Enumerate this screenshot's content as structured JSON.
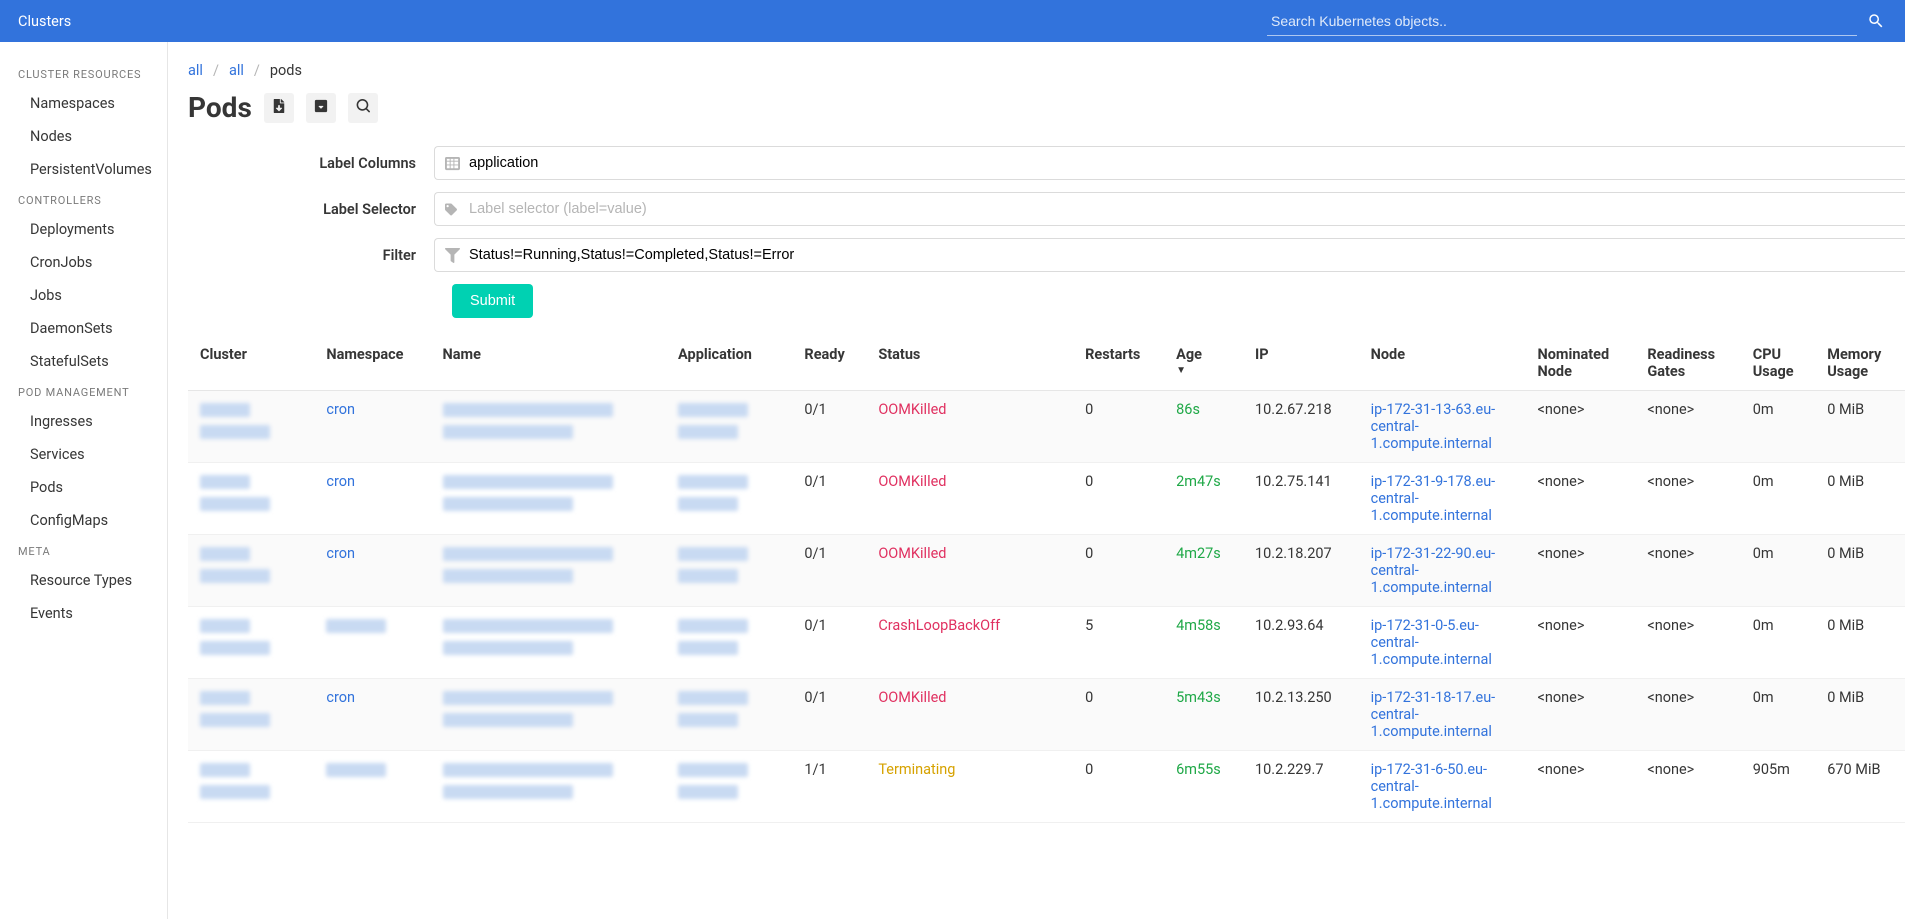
{
  "topbar": {
    "title": "Clusters",
    "search_placeholder": "Search Kubernetes objects.."
  },
  "sidebar": {
    "sections": [
      {
        "title": "CLUSTER RESOURCES",
        "items": [
          "Namespaces",
          "Nodes",
          "PersistentVolumes"
        ]
      },
      {
        "title": "CONTROLLERS",
        "items": [
          "Deployments",
          "CronJobs",
          "Jobs",
          "DaemonSets",
          "StatefulSets"
        ]
      },
      {
        "title": "POD MANAGEMENT",
        "items": [
          "Ingresses",
          "Services",
          "Pods",
          "ConfigMaps"
        ]
      },
      {
        "title": "META",
        "items": [
          "Resource Types",
          "Events"
        ]
      }
    ]
  },
  "breadcrumb": {
    "a": "all",
    "b": "all",
    "c": "pods"
  },
  "page": {
    "title": "Pods"
  },
  "form": {
    "label_columns_label": "Label Columns",
    "label_columns_value": "application",
    "label_selector_label": "Label Selector",
    "label_selector_placeholder": "Label selector (label=value)",
    "filter_label": "Filter",
    "filter_value": "Status!=Running,Status!=Completed,Status!=Error",
    "submit": "Submit"
  },
  "columns": [
    "Cluster",
    "Namespace",
    "Name",
    "Application",
    "Ready",
    "Status",
    "Restarts",
    "Age",
    "IP",
    "Node",
    "Nominated Node",
    "Readiness Gates",
    "CPU Usage",
    "Memory Usage"
  ],
  "sort_column": "Age",
  "none_text": "<none>",
  "rows": [
    {
      "namespace": "cron",
      "ready": "0/1",
      "status": "OOMKilled",
      "status_class": "status-red",
      "restarts": "0",
      "age": "86s",
      "ip": "10.2.67.218",
      "node": "ip-172-31-13-63.eu-central-1.compute.internal",
      "cpu": "0m",
      "mem": "0 MiB"
    },
    {
      "namespace": "cron",
      "ready": "0/1",
      "status": "OOMKilled",
      "status_class": "status-red",
      "restarts": "0",
      "age": "2m47s",
      "ip": "10.2.75.141",
      "node": "ip-172-31-9-178.eu-central-1.compute.internal",
      "cpu": "0m",
      "mem": "0 MiB"
    },
    {
      "namespace": "cron",
      "ready": "0/1",
      "status": "OOMKilled",
      "status_class": "status-red",
      "restarts": "0",
      "age": "4m27s",
      "ip": "10.2.18.207",
      "node": "ip-172-31-22-90.eu-central-1.compute.internal",
      "cpu": "0m",
      "mem": "0 MiB"
    },
    {
      "namespace": "",
      "ready": "0/1",
      "status": "CrashLoopBackOff",
      "status_class": "status-red",
      "restarts": "5",
      "age": "4m58s",
      "ip": "10.2.93.64",
      "node": "ip-172-31-0-5.eu-central-1.compute.internal",
      "cpu": "0m",
      "mem": "0 MiB"
    },
    {
      "namespace": "cron",
      "ready": "0/1",
      "status": "OOMKilled",
      "status_class": "status-red",
      "restarts": "0",
      "age": "5m43s",
      "ip": "10.2.13.250",
      "node": "ip-172-31-18-17.eu-central-1.compute.internal",
      "cpu": "0m",
      "mem": "0 MiB"
    },
    {
      "namespace": "",
      "ready": "1/1",
      "status": "Terminating",
      "status_class": "status-yellow",
      "restarts": "0",
      "age": "6m55s",
      "ip": "10.2.229.7",
      "node": "ip-172-31-6-50.eu-central-1.compute.internal",
      "cpu": "905m",
      "mem": "670 MiB"
    }
  ]
}
